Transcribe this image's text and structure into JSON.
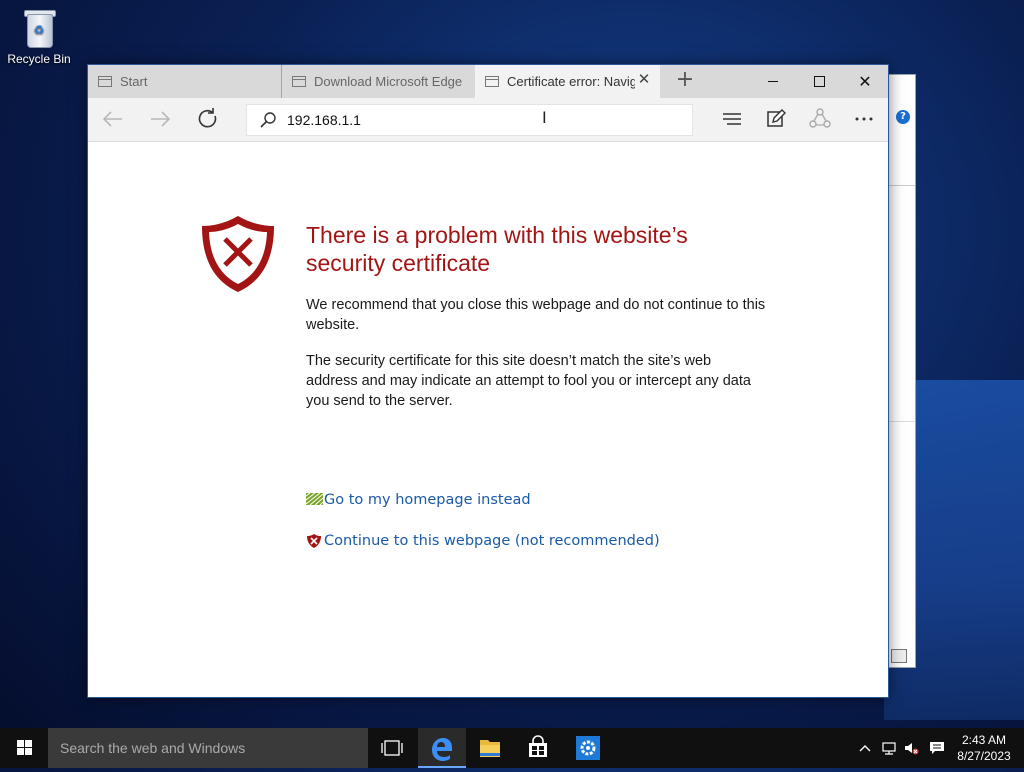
{
  "desktop": {
    "recycle_bin_label": "Recycle Bin"
  },
  "browser": {
    "tabs": [
      {
        "label": "Start",
        "active": false
      },
      {
        "label": "Download Microsoft Edge",
        "active": false
      },
      {
        "label": "Certificate error: Navigation blocked",
        "active": true
      }
    ],
    "address": "192.168.1.1"
  },
  "page": {
    "heading": "There is a problem with this website’s security certificate",
    "para1": "We recommend that you close this webpage and do not continue to this website.",
    "para2": "The security certificate for this site doesn’t match the site’s web address and may indicate an attempt to fool you or intercept any data you send to the server.",
    "link_home": "Go to my homepage instead",
    "link_continue": "Continue to this webpage (not recommended)"
  },
  "taskbar": {
    "search_placeholder": "Search the web and Windows",
    "time": "2:43 AM",
    "date": "8/27/2023"
  },
  "colors": {
    "error_red": "#a31515",
    "link_blue": "#1a5aa6",
    "accent": "#1e7ad6"
  }
}
